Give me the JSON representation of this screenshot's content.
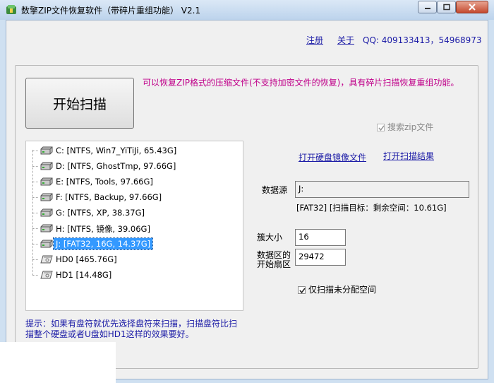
{
  "window": {
    "title": "数擎ZIP文件恢复软件（带碎片重组功能） V2.1"
  },
  "header_links": {
    "register": "注册",
    "about": "关于",
    "qq": "QQ: 409133413，54968973"
  },
  "scan_button": "开始扫描",
  "notice": "可以恢复ZIP格式的压缩文件(不支持加密文件的恢复)，具有碎片扫描恢复重组功能。",
  "search_zip": {
    "label": "搜索zip文件",
    "checked": true,
    "enabled": false
  },
  "drives": [
    {
      "label": "C:  [NTFS, Win7_YiTiJi, 65.43G]",
      "type": "volume",
      "icon": "drive-icon"
    },
    {
      "label": "D:  [NTFS, GhostTmp, 97.66G]",
      "type": "volume",
      "icon": "drive-icon"
    },
    {
      "label": "E:  [NTFS, Tools, 97.66G]",
      "type": "volume",
      "icon": "drive-icon"
    },
    {
      "label": "F:  [NTFS, Backup, 97.66G]",
      "type": "volume",
      "icon": "drive-icon"
    },
    {
      "label": "G:  [NTFS, XP, 38.37G]",
      "type": "volume",
      "icon": "drive-icon"
    },
    {
      "label": "H:  [NTFS, 镜像, 39.06G]",
      "type": "volume",
      "icon": "drive-icon"
    },
    {
      "label": "J:  [FAT32, 16G, 14.37G]",
      "type": "volume",
      "icon": "drive-icon",
      "selected": true
    },
    {
      "label": "HD0  [465.76G]",
      "type": "disk",
      "icon": "hard-disk-icon"
    },
    {
      "label": "HD1  [14.48G]",
      "type": "disk",
      "icon": "hard-disk-icon"
    }
  ],
  "open_image_link": "打开硬盘镜像文件",
  "open_result_link": "打开扫描结果",
  "source": {
    "label": "数据源",
    "value": "J:",
    "info": "[FAT32]  [扫描目标：剩余空间：10.61G]"
  },
  "cluster": {
    "label": "簇大小",
    "value": "16"
  },
  "start_sector": {
    "label_line1": "数据区的",
    "label_line2": "开始扇区",
    "value": "29472"
  },
  "unallocated": {
    "label": "仅扫描未分配空间",
    "checked": true
  },
  "hint": "提示：如果有盘符就优先选择盘符来扫描，扫描盘符比扫描整个硬盘或者U盘如HD1这样的效果要好。",
  "colors": {
    "notice": "#c0008a",
    "link": "#1a1aa6",
    "selection": "#3399ff"
  }
}
